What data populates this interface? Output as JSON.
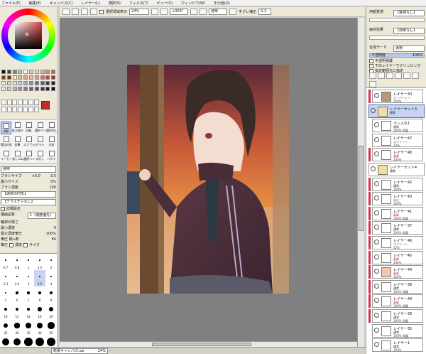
{
  "menu": {
    "items": [
      "ファイル(F)",
      "編集(E)",
      "キャンバス(C)",
      "レイヤー(L)",
      "選択(S)",
      "フィルタ(T)",
      "ビュー(V)",
      "ウィンドウ(W)",
      "その他(O)"
    ]
  },
  "toolbar": {
    "selection_display_label": "選択領域表示",
    "zoom_value": "24%",
    "rotation_value": "+000°",
    "blend_value": "通常",
    "stabilizer_label": "手ブレ補正",
    "stabilizer_value": "S-3"
  },
  "left_panel": {
    "tool_labels": [
      "移動",
      "拡大縮小",
      "回転",
      "選択ペン",
      "選択消し",
      "魔法の杖",
      "鉛筆",
      "エアブラシ",
      "ブラシ",
      "水彩",
      "マーカー",
      "消しゴム",
      "選択ペン",
      "ぼかし",
      "バケツ"
    ],
    "blend_mode": "通常",
    "brush_size_label": "ブラシサイズ",
    "brush_size_mult": "×5.0",
    "brush_size_value": "3.5",
    "min_size_label": "最小サイズ",
    "min_size_value": "0%",
    "density_label": "ブラシ濃度",
    "density_value": "100",
    "shape_label": "【通常の円形】",
    "texture_label": "【テクスチャなし】",
    "advanced_label": "詳細設定",
    "quality_label": "描画品質",
    "quality_value": "1（速度優先）",
    "edge_label": "輪郭の硬さ",
    "min_density_label": "最小濃度",
    "min_density_value": "0",
    "max_pressure_label": "最大濃度筆圧",
    "max_pressure_value": "100%",
    "pressure_label": "筆圧 硬⇔軟",
    "pressure_value": "84",
    "pressure_toggles_label": "筆圧",
    "pressure_density_label": "濃度",
    "pressure_size_label": "サイズ",
    "brush_sizes": [
      "0.7",
      "0.8",
      "1",
      "1.5",
      "2",
      "2.3",
      "2.6",
      "3",
      "3.5",
      "4",
      "5",
      "6",
      "7",
      "8",
      "9",
      "10",
      "12",
      "14",
      "16",
      "20",
      "25",
      "30",
      "35",
      "40",
      "50",
      "60",
      "70",
      "80",
      "100",
      "120"
    ]
  },
  "right_panel": {
    "paper_texture_label": "用紙質感",
    "paper_texture_value": "【質感なし】",
    "paper_effect_label": "画材効果",
    "paper_effect_value": "【効果なし】",
    "blend_label": "合成モード",
    "blend_value": "通常",
    "opacity_label": "不透明度",
    "opacity_value": "100%",
    "protect_alpha_label": "不透明保護",
    "clip_label": "下のレイヤーでクリッピング",
    "select_source_label": "指定範囲元に指定",
    "layers": [
      {
        "name": "レイヤー30",
        "mode": "オーバーレイ",
        "opacity": "100%",
        "folder": false,
        "selected": false,
        "red": true,
        "thumb": "#b89878"
      },
      {
        "name": "レイヤーセット3",
        "mode": "通常",
        "opacity": "",
        "folder": true,
        "selected": true,
        "red": false,
        "thumb": "#ffffff"
      },
      {
        "name": "ペン入れ1",
        "mode": "通常",
        "opacity": "100% 保護",
        "folder": false,
        "selected": false,
        "red": false,
        "thumb": "#ffffff"
      },
      {
        "name": "レイヤー47",
        "mode": "スクリーン",
        "opacity": "33%",
        "folder": false,
        "selected": false,
        "red": false,
        "thumb": "#ffffff"
      },
      {
        "name": "レイヤー48",
        "mode": "乗算",
        "opacity": "100%",
        "folder": false,
        "selected": false,
        "red": true,
        "thumb": "#ffffff"
      },
      {
        "name": "レイヤーセット4",
        "mode": "通常",
        "opacity": "",
        "folder": true,
        "selected": false,
        "red": false,
        "thumb": "#ffffff"
      },
      {
        "name": "レイヤー42",
        "mode": "通常",
        "opacity": "100%",
        "folder": false,
        "selected": false,
        "red": true,
        "thumb": "#ffffff"
      },
      {
        "name": "レイヤー43",
        "mode": "発光",
        "opacity": "100%",
        "folder": false,
        "selected": false,
        "red": true,
        "thumb": "#ffffff"
      },
      {
        "name": "レイヤー41",
        "mode": "乗算",
        "opacity": "100% 保護",
        "folder": false,
        "selected": false,
        "red": true,
        "thumb": "#ffffff"
      },
      {
        "name": "レイヤー37",
        "mode": "通常",
        "opacity": "100% 保護",
        "folder": false,
        "selected": false,
        "red": true,
        "thumb": "#ffffff"
      },
      {
        "name": "レイヤー46",
        "mode": "スクリーン",
        "opacity": "32%",
        "folder": false,
        "selected": false,
        "red": true,
        "thumb": "#ffffff"
      },
      {
        "name": "レイヤー45",
        "mode": "乗算",
        "opacity": "100%",
        "folder": false,
        "selected": false,
        "red": true,
        "thumb": "#ffffff"
      },
      {
        "name": "レイヤー44",
        "mode": "乗算",
        "opacity": "100%",
        "folder": false,
        "selected": false,
        "red": true,
        "thumb": "#f0c8b0"
      },
      {
        "name": "レイヤー38",
        "mode": "通常",
        "opacity": "100% 保護",
        "folder": false,
        "selected": false,
        "red": true,
        "thumb": "#ffffff"
      },
      {
        "name": "レイヤー40",
        "mode": "乗算",
        "opacity": "100% 保護",
        "folder": false,
        "selected": false,
        "red": true,
        "thumb": "#ffffff"
      },
      {
        "name": "レイヤー39",
        "mode": "通常",
        "opacity": "100% 保護",
        "folder": false,
        "selected": false,
        "red": true,
        "thumb": "#ffffff"
      },
      {
        "name": "レイヤー35",
        "mode": "通常",
        "opacity": "100% 保護",
        "folder": false,
        "selected": false,
        "red": false,
        "thumb": "#ffffff"
      },
      {
        "name": "レイヤー1",
        "mode": "通常",
        "opacity": "100%",
        "folder": false,
        "selected": false,
        "red": false,
        "thumb": "#ffffff"
      }
    ]
  },
  "status": {
    "tab_label": "新規キャンバス.sai",
    "tab_zoom": "24%"
  },
  "colors": {
    "accent": "#5070b0",
    "panel": "#ece9d8",
    "canvas_bg": "#808080",
    "primary_color": "#c03028"
  }
}
